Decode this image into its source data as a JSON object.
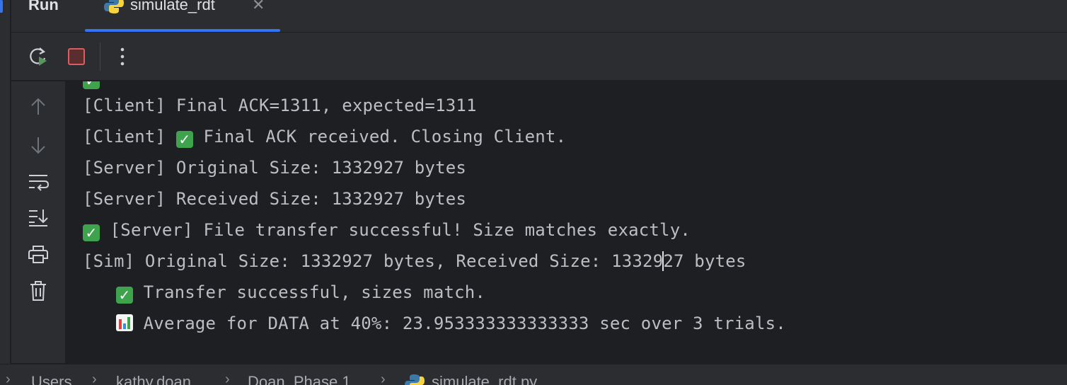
{
  "header": {
    "title": "Run"
  },
  "tab": {
    "label": "simulate_rdt"
  },
  "console": {
    "line_a": "[Client] Final ACK=1311, expected=1311",
    "line_b_prefix": "[Client] ",
    "line_b_rest": " Final ACK received. Closing Client.",
    "line_c": "[Server] Original Size: 1332927 bytes",
    "line_d": "[Server] Received Size: 1332927 bytes",
    "line_e_rest": " [Server] File transfer successful! Size matches exactly.",
    "line_f_a": "[Sim] Original Size: 1332927 bytes, Received Size: 13329",
    "line_f_b": "27 bytes",
    "line_g_rest": " Transfer successful, sizes match.",
    "line_h_rest": " Average for DATA at 40%: 23.953333333333333 sec over 3 trials."
  },
  "breadcrumb": {
    "items": [
      "Users",
      "kathy.doan",
      "Doan_Phase 1",
      "simulate_rdt.py"
    ]
  },
  "colors": {
    "accent": "#3574f0",
    "stop": "#db5c5c",
    "success": "#3fa34d"
  }
}
